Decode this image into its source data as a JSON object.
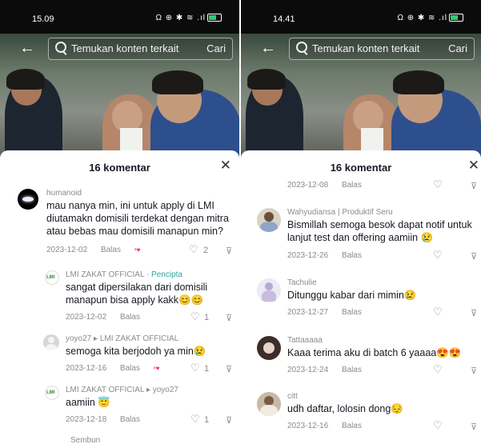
{
  "left": {
    "status_time": "15.09",
    "search_placeholder": "Temukan konten terkait",
    "search_button": "Cari",
    "sheet_title": "16 komentar",
    "comments": [
      {
        "username": "humanoid",
        "text": "mau nanya min, ini untuk apply di LMI diutamakn domisili terdekat dengan mitra atau bebas mau domisili manapun min?",
        "date": "2023-12-02",
        "reply": "Balas",
        "likes": "2"
      },
      {
        "username": "LMI ZAKAT OFFICIAL",
        "badge": " · Pencipta",
        "text": "sangat dipersilakan dari domisili manapun bisa apply kakk😊😊",
        "date": "2023-12-02",
        "reply": "Balas",
        "likes": "1"
      },
      {
        "username": "yoyo27 ▸ LMI ZAKAT OFFICIAL",
        "text": "semoga kita berjodoh ya min😢",
        "date": "2023-12-16",
        "reply": "Balas",
        "likes": "1"
      },
      {
        "username": "LMI ZAKAT OFFICIAL ▸ yoyo27",
        "text": "aamiin 😇",
        "date": "2023-12-18",
        "reply": "Balas",
        "likes": "1"
      }
    ],
    "more_label": "Sembun"
  },
  "right": {
    "status_time": "14.41",
    "search_placeholder": "Temukan konten terkait",
    "search_button": "Cari",
    "sheet_title": "16 komentar",
    "top_meta": {
      "date": "2023-12-08",
      "reply": "Balas"
    },
    "comments": [
      {
        "username": "Wahyudiansa | Produktif Seru",
        "text": "Bismillah semoga besok dapat notif untuk lanjut test dan offering aamiin 😢",
        "date": "2023-12-26",
        "reply": "Balas"
      },
      {
        "username": "Tachulie",
        "text": "Ditunggu kabar dari mimin😢",
        "date": "2023-12-27",
        "reply": "Balas"
      },
      {
        "username": "Tattaaaaa",
        "text": "Kaaa terima aku di batch 6 yaaaa😍😍",
        "date": "2023-12-24",
        "reply": "Balas"
      },
      {
        "username": "citt",
        "text": "udh daftar, lolosin dong😔",
        "date": "2023-12-16",
        "reply": "Balas"
      }
    ]
  },
  "icons": {
    "back": "←",
    "close": "✕",
    "heart": "♡",
    "dislike": "👎"
  },
  "colors": {
    "creator_tag": "#2aa6a0",
    "liked_heart": "#fe2c55",
    "meta_gray": "#8a8b91",
    "text": "#161823"
  }
}
